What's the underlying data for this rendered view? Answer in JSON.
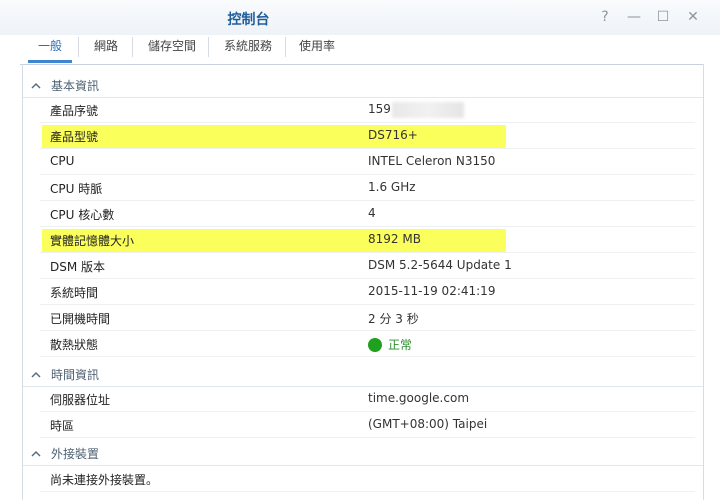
{
  "window": {
    "title": "控制台",
    "help": "?",
    "minimize": "—",
    "maximize": "☐",
    "close": "✕"
  },
  "tabs": [
    "一般",
    "網路",
    "儲存空間",
    "系統服務",
    "使用率"
  ],
  "sections": {
    "basic": "基本資訊",
    "time": "時間資訊",
    "external": "外接裝置"
  },
  "basic_rows": [
    {
      "label": "產品序號",
      "value": "159"
    },
    {
      "label": "產品型號",
      "value": "DS716+"
    },
    {
      "label": "CPU",
      "value": "INTEL Celeron N3150"
    },
    {
      "label": "CPU 時脈",
      "value": "1.6 GHz"
    },
    {
      "label": "CPU 核心數",
      "value": "4"
    },
    {
      "label": "實體記憶體大小",
      "value": "8192 MB"
    },
    {
      "label": "DSM 版本",
      "value": "DSM 5.2-5644 Update 1"
    },
    {
      "label": "系統時間",
      "value": "2015-11-19 02:41:19"
    },
    {
      "label": "已開機時間",
      "value": "2 分 3 秒"
    },
    {
      "label": "散熱狀態",
      "value": "正常"
    }
  ],
  "time_rows": [
    {
      "label": "伺服器位址",
      "value": "time.google.com"
    },
    {
      "label": "時區",
      "value": "(GMT+08:00) Taipei"
    }
  ],
  "external_rows": [
    {
      "label": "尚未連接外接裝置。"
    }
  ],
  "colors": {
    "highlight": "#fbff5b",
    "status_ok": "#1fa11f",
    "tab_active": "#3f86d1"
  }
}
